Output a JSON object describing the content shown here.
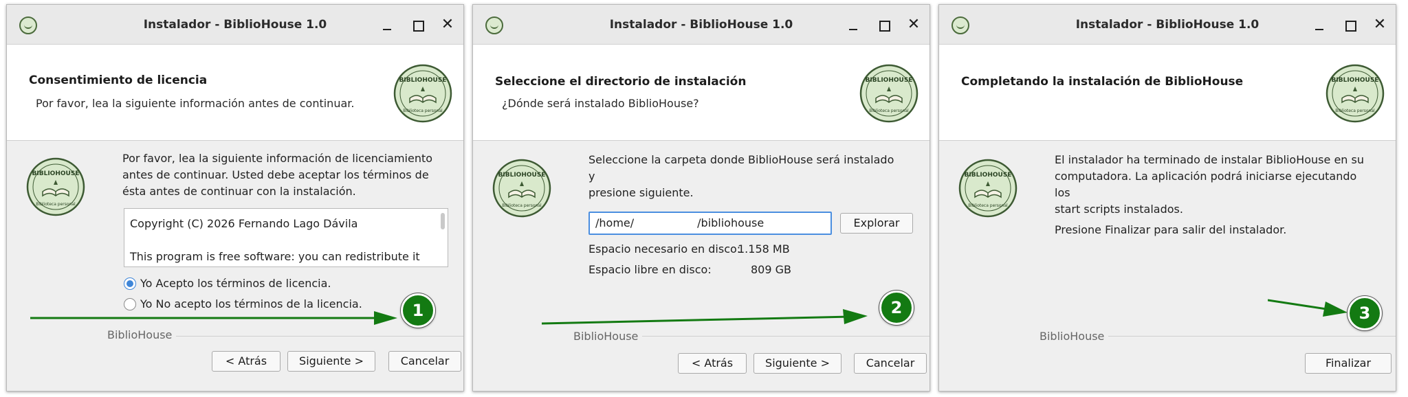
{
  "window_title": "Instalador - BiblioHouse 1.0",
  "window_controls": {
    "close": "✕"
  },
  "logo_text": {
    "top": "BIBLIOHOUSE",
    "bottom": "Biblioteca personal"
  },
  "accent_color": "#3f86d8",
  "arrow_color": "#137a12",
  "footer_brand": "BiblioHouse",
  "steps": [
    {
      "header": {
        "title": "Consentimiento de licencia",
        "subtitle": "Por favor, lea la siguiente información antes de continuar."
      },
      "body": [
        "Por favor, lea la siguiente información de licenciamiento",
        "antes de continuar. Usted debe aceptar los términos de",
        "ésta antes de continuar con la instalación."
      ],
      "license_lines": [
        "Copyright (C) 2026 Fernando Lago Dávila",
        "This program is free software: you can redistribute it"
      ],
      "radios": [
        {
          "label": "Yo Acepto los términos de licencia.",
          "checked": true
        },
        {
          "label": "Yo No acepto los términos de la licencia.",
          "checked": false
        }
      ],
      "badge": "1",
      "buttons": {
        "back": "< Atrás",
        "next": "Siguiente >",
        "cancel": "Cancelar"
      }
    },
    {
      "header": {
        "title": "Seleccione el directorio de instalación",
        "subtitle": "¿Dónde será instalado BiblioHouse?"
      },
      "body": [
        "Seleccione la carpeta donde BiblioHouse será instalado y",
        "presione siguiente."
      ],
      "path_prefix": "/home/",
      "path_suffix": "/bibliohouse",
      "browse": "Explorar",
      "space_required_label": "Espacio necesario en disco:",
      "space_required_value": "1.158 MB",
      "space_free_label": "Espacio libre en disco:",
      "space_free_value": "809 GB",
      "badge": "2",
      "buttons": {
        "back": "< Atrás",
        "next": "Siguiente >",
        "cancel": "Cancelar"
      }
    },
    {
      "header": {
        "title": "Completando la instalación de BiblioHouse"
      },
      "body": [
        "El instalador ha terminado de instalar BiblioHouse en su",
        "computadora. La aplicación podrá iniciarse ejecutando los",
        "start scripts instalados."
      ],
      "body2": "Presione Finalizar para salir del instalador.",
      "badge": "3",
      "buttons": {
        "finish": "Finalizar"
      }
    }
  ]
}
